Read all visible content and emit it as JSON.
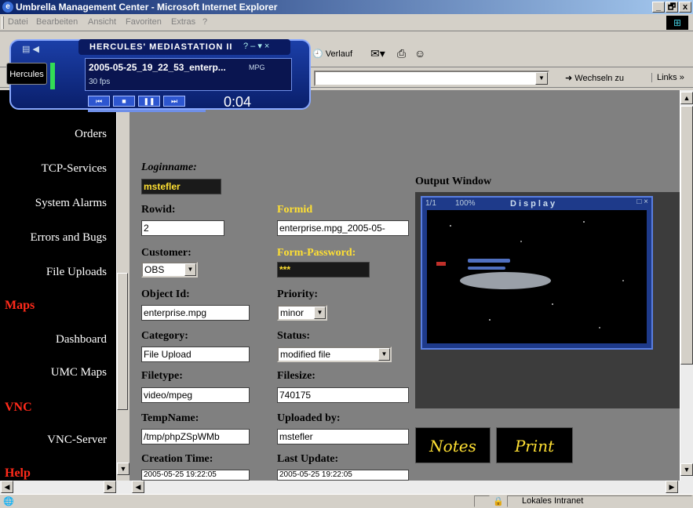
{
  "window": {
    "title": "Umbrella Management Center - Microsoft Internet Explorer",
    "min": "_",
    "max": "🗗",
    "close": "x"
  },
  "menu": [
    "Datei",
    "Bearbeiten",
    "Ansicht",
    "Favoriten",
    "Extras",
    "?"
  ],
  "toolbar": {
    "verlauf": "Verlauf",
    "wechseln": "Wechseln zu",
    "links": "Links »"
  },
  "player": {
    "brand": "Hercules",
    "title": "HERCULES' MEDIASTATION II",
    "track": "2005-05-25_19_22_53_enterp...",
    "format": "MPG",
    "fps": "30 fps",
    "time": "0:04"
  },
  "nav": {
    "items": [
      "Orders",
      "TCP-Services",
      "System Alarms",
      "Errors and Bugs",
      "File Uploads"
    ],
    "maps_head": "Maps",
    "maps_items": [
      "Dashboard",
      "UMC Maps"
    ],
    "vnc_head": "VNC",
    "vnc_items": [
      "VNC-Server"
    ],
    "help_head": "Help"
  },
  "form": {
    "loginname_label": "Loginname:",
    "loginname": "mstefler",
    "rowid_label": "Rowid:",
    "rowid": "2",
    "formid_label": "Formid",
    "formid": "enterprise.mpg_2005-05-",
    "customer_label": "Customer:",
    "customer": "OBS",
    "formpw_label": "Form-Password:",
    "formpw": "***",
    "objectid_label": "Object Id:",
    "objectid": "enterprise.mpg",
    "priority_label": "Priority:",
    "priority": "minor",
    "category_label": "Category:",
    "category": "File Upload",
    "status_label": "Status:",
    "status": "modified file",
    "filetype_label": "Filetype:",
    "filetype": "video/mpeg",
    "filesize_label": "Filesize:",
    "filesize": "740175",
    "tempname_label": "TempName:",
    "tempname": "/tmp/phpZSpWMb",
    "uploadedby_label": "Uploaded by:",
    "uploadedby": "mstefler",
    "creation_label": "Creation Time:",
    "creation": "2005-05-25 19:22:05",
    "lastupdate_label": "Last Update:",
    "lastupdate": "2005-05-25 19:22:05"
  },
  "output": {
    "label": "Output Window",
    "page": "1/1",
    "zoom": "100%",
    "display": "Display"
  },
  "buttons": {
    "notes": "Notes",
    "print": "Print"
  },
  "status": {
    "zone": "Lokales Intranet"
  }
}
